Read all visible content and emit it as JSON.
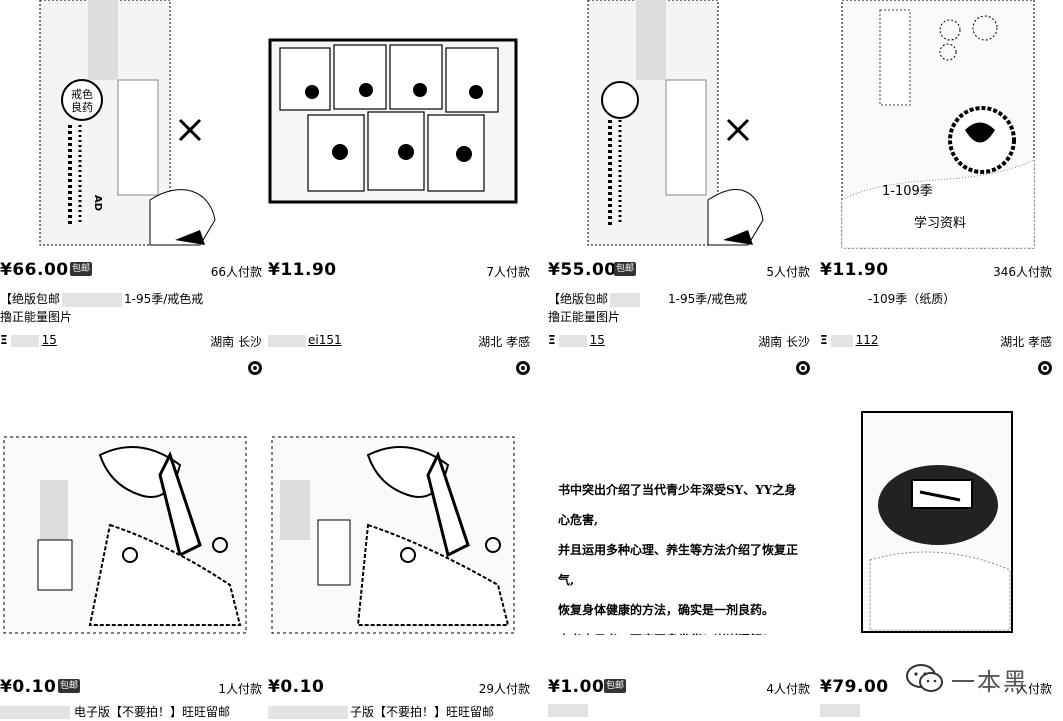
{
  "products": [
    {
      "price": "¥66.00",
      "badge": "包邮",
      "paid": "66人付款",
      "title": [
        "【绝版包邮",
        "1-95季/戒色戒",
        "撸正能量图片"
      ],
      "shop": "15",
      "location": "湖南 长沙"
    },
    {
      "price": "¥11.90",
      "badge": "",
      "paid": "7人付款",
      "title": [
        "",
        "",
        ""
      ],
      "shop": "ei151",
      "location": "湖北 孝感"
    },
    {
      "price": "¥55.00",
      "badge": "包邮",
      "paid": "5人付款",
      "title": [
        "【绝版包邮",
        "1-95季/戒色戒",
        "撸正能量图片"
      ],
      "shop": "15",
      "location": "湖南 长沙"
    },
    {
      "price": "¥11.90",
      "badge": "",
      "paid": "346人付款",
      "title": [
        "",
        "-109季（纸质）",
        ""
      ],
      "shop": "112",
      "location": "湖北 孝感"
    },
    {
      "price": "¥0.10",
      "badge": "包邮",
      "paid": "1人付款",
      "title": [
        "电子版【不要拍！】旺旺留邮"
      ]
    },
    {
      "price": "¥0.10",
      "badge": "包邮",
      "paid": "29人付款",
      "title": [
        "子版【不要拍！】旺旺留邮"
      ]
    },
    {
      "price": "¥1.00",
      "badge": "包邮",
      "paid": "4人付款",
      "title": [
        ""
      ]
    },
    {
      "price": "¥79.00",
      "badge": "",
      "paid": "人付款",
      "title": [
        ""
      ]
    }
  ],
  "image_texts": {
    "card4_label1": "1-109季",
    "card4_label2": "学习资料",
    "card7_lines": [
      "书中突出介绍了当代青少年深受SY、YY之身心危害,",
      "并且运用多种心理、养生等方法介绍了恢复正气,",
      "恢复身体健康的方法，确实是一剂良药。",
      "本书电子书，百度网盘发货！谢谢理解！"
    ],
    "card1_stamp": "戒色良药",
    "card1_box_letters": "AD"
  },
  "watermark": {
    "text": "一本黑"
  }
}
